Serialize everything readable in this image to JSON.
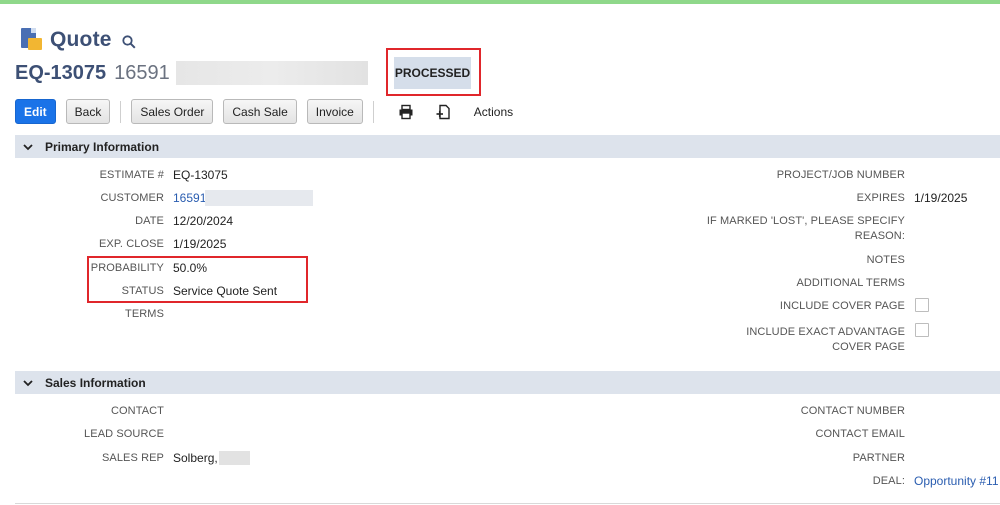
{
  "header": {
    "page_title": "Quote",
    "record_id": "EQ-13075",
    "record_number": "16591",
    "status": "PROCESSED"
  },
  "toolbar": {
    "edit": "Edit",
    "back": "Back",
    "sales_order": "Sales Order",
    "cash_sale": "Cash Sale",
    "invoice": "Invoice",
    "actions": "Actions"
  },
  "primary": {
    "title": "Primary Information",
    "estimate_label": "ESTIMATE #",
    "estimate_value": "EQ-13075",
    "customer_label": "CUSTOMER",
    "customer_value": "16591",
    "date_label": "DATE",
    "date_value": "12/20/2024",
    "exp_close_label": "EXP. CLOSE",
    "exp_close_value": "1/19/2025",
    "probability_label": "PROBABILITY",
    "probability_value": "50.0%",
    "status_label": "STATUS",
    "status_value": "Service Quote Sent",
    "terms_label": "TERMS",
    "project_label": "PROJECT/JOB NUMBER",
    "expires_label": "EXPIRES",
    "expires_value": "1/19/2025",
    "lost_reason_label": "IF MARKED 'LOST', PLEASE SPECIFY REASON:",
    "notes_label": "NOTES",
    "additional_terms_label": "ADDITIONAL TERMS",
    "cover_page_label": "INCLUDE COVER PAGE",
    "exact_cover_label": "INCLUDE EXACT ADVANTAGE COVER PAGE"
  },
  "sales": {
    "title": "Sales Information",
    "contact_label": "CONTACT",
    "lead_source_label": "LEAD SOURCE",
    "sales_rep_label": "SALES REP",
    "sales_rep_value": "Solberg,",
    "contact_number_label": "CONTACT NUMBER",
    "contact_email_label": "CONTACT EMAIL",
    "partner_label": "PARTNER",
    "deal_label": "DEAL:",
    "deal_value": "Opportunity #11"
  },
  "colors": {
    "accent": "#1a73e8",
    "title": "#3d5075",
    "highlight": "#e0262b",
    "section_bg": "#dde3ec",
    "badge_bg": "#d5deea",
    "link": "#2a5db0"
  }
}
